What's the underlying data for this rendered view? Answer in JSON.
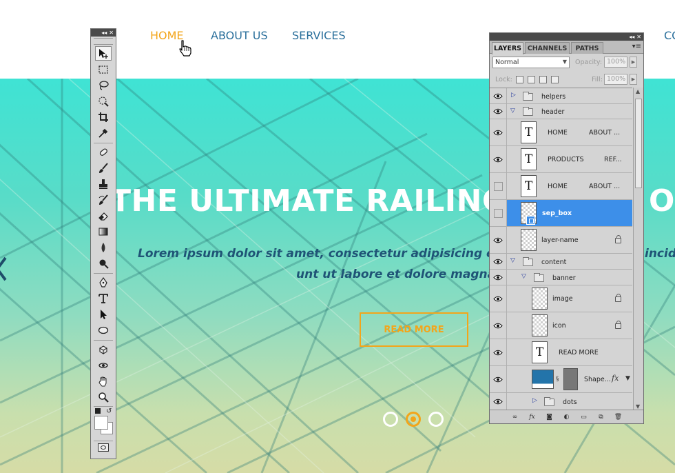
{
  "site": {
    "nav": [
      {
        "label": "HOME",
        "active": true
      },
      {
        "label": "ABOUT US",
        "active": false
      },
      {
        "label": "SERVICES",
        "active": false
      },
      {
        "label": "CO",
        "active": false
      }
    ],
    "hero": {
      "title": "THE ULTIMATE RAILING",
      "title_tail": "OI",
      "subtitle_line1": "Lorem ipsum dolor sit amet, consectetur adipisicing elit,",
      "subtitle_tail": "incid",
      "subtitle_line2": "unt ut labore et dolore magna",
      "button": "READ MORE",
      "dots": [
        false,
        true,
        false
      ]
    },
    "colors": {
      "accent": "#f3a51a",
      "nav_text": "#2a6f9b",
      "subtitle": "#1f5476"
    }
  },
  "tools_panel": {
    "icons": [
      "move-tool",
      "marquee-tool",
      "lasso-tool",
      "quick-selection-tool",
      "crop-tool",
      "eyedropper-tool",
      "healing-brush-tool",
      "brush-tool",
      "clone-stamp-tool",
      "history-brush-tool",
      "eraser-tool",
      "gradient-tool",
      "blur-tool",
      "dodge-tool",
      "pen-tool",
      "type-tool",
      "path-selection-tool",
      "shape-tool",
      "3d-rotate-tool",
      "3d-orbit-tool",
      "hand-tool",
      "zoom-tool"
    ],
    "selected": "move-tool"
  },
  "layers_panel": {
    "tabs": [
      "LAYERS",
      "CHANNELS",
      "PATHS"
    ],
    "active_tab": "LAYERS",
    "blend_mode": "Normal",
    "opacity_label": "Opacity:",
    "opacity": "100%",
    "lock_label": "Lock:",
    "fill_label": "Fill:",
    "fill": "100%",
    "layers": [
      {
        "name": "helpers",
        "kind": "group",
        "collapsed": true,
        "visible": true,
        "depth": 0
      },
      {
        "name": "header",
        "kind": "group",
        "collapsed": false,
        "visible": true,
        "depth": 0
      },
      {
        "name": "HOME",
        "extra": "ABOUT ...",
        "kind": "text",
        "visible": true,
        "depth": 1
      },
      {
        "name": "PRODUCTS",
        "extra": "REF...",
        "kind": "text",
        "visible": true,
        "depth": 1
      },
      {
        "name": "HOME",
        "extra": "ABOUT ...",
        "kind": "text",
        "visible": false,
        "depth": 1
      },
      {
        "name": "sep_box",
        "kind": "smart",
        "visible": false,
        "selected": true,
        "depth": 1
      },
      {
        "name": "layer-name",
        "kind": "raster",
        "visible": true,
        "locked": true,
        "depth": 1
      },
      {
        "name": "content",
        "kind": "group",
        "collapsed": false,
        "visible": true,
        "depth": 0
      },
      {
        "name": "banner",
        "kind": "group",
        "collapsed": false,
        "visible": true,
        "depth": 1
      },
      {
        "name": "image",
        "kind": "raster",
        "visible": true,
        "locked": true,
        "depth": 2
      },
      {
        "name": "icon",
        "kind": "raster",
        "visible": true,
        "locked": true,
        "depth": 2
      },
      {
        "name": "READ MORE",
        "kind": "text",
        "visible": true,
        "depth": 2
      },
      {
        "name": "Shape...",
        "kind": "shape",
        "visible": true,
        "fx": "fx",
        "depth": 2
      },
      {
        "name": "dots",
        "kind": "group",
        "collapsed": true,
        "visible": true,
        "depth": 2
      }
    ],
    "footer_icons": [
      "link-layers-icon",
      "add-style-icon",
      "add-mask-icon",
      "adjustment-layer-icon",
      "new-group-icon",
      "new-layer-icon",
      "delete-layer-icon"
    ]
  }
}
